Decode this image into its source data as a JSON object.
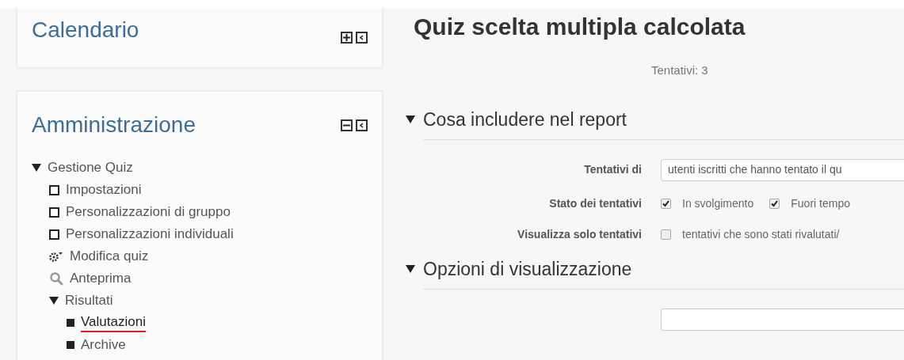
{
  "blocks": [
    {
      "title": "Calendario",
      "expanded": false
    },
    {
      "title": "Amministrazione",
      "expanded": true,
      "tree": [
        {
          "label": "Gestione Quiz",
          "kind": "folder",
          "expanded": true,
          "children": [
            {
              "label": "Impostazioni",
              "kind": "page",
              "selected": false
            },
            {
              "label": "Personalizzazioni di gruppo",
              "kind": "page",
              "selected": false
            },
            {
              "label": "Personalizzazioni individuali",
              "kind": "page",
              "selected": false
            },
            {
              "label": "Modifica quiz",
              "kind": "gear",
              "selected": false
            },
            {
              "label": "Anteprima",
              "kind": "search",
              "selected": false
            },
            {
              "label": "Risultati",
              "kind": "folder",
              "expanded": true,
              "children": [
                {
                  "label": "Valutazioni",
                  "kind": "bullet",
                  "selected": true
                },
                {
                  "label": "Archive",
                  "kind": "bullet",
                  "selected": false
                }
              ]
            }
          ]
        }
      ]
    }
  ],
  "main": {
    "title": "Quiz scelta multipla calcolata",
    "attempts": "Tentativi: 3",
    "sections": [
      {
        "title": "Cosa includere nel report",
        "expanded": true,
        "rows": [
          {
            "label": "Tentativi di",
            "kind": "select",
            "value": "utenti iscritti che hanno tentato il qu"
          },
          {
            "label": "Stato dei tentativi",
            "kind": "checks",
            "options": [
              {
                "label": "In svolgimento",
                "checked": true
              },
              {
                "label": "Fuori tempo",
                "checked": true
              }
            ]
          },
          {
            "label": "Visualizza solo tentativi",
            "kind": "checks",
            "options": [
              {
                "label": "tentativi che sono stati rivalutati/",
                "checked": false
              }
            ]
          }
        ]
      },
      {
        "title": "Opzioni di visualizzazione",
        "expanded": true,
        "rows": [
          {
            "label": "",
            "kind": "select",
            "value": ""
          }
        ]
      }
    ]
  }
}
